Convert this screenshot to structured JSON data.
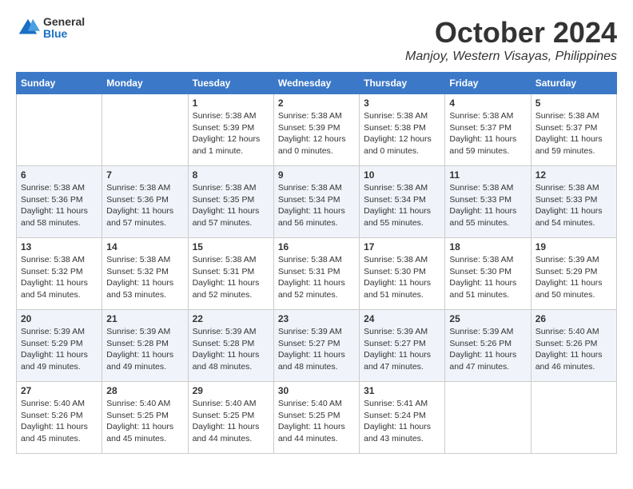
{
  "header": {
    "logo": {
      "general": "General",
      "blue": "Blue"
    },
    "title": "October 2024",
    "location": "Manjoy, Western Visayas, Philippines"
  },
  "weekdays": [
    "Sunday",
    "Monday",
    "Tuesday",
    "Wednesday",
    "Thursday",
    "Friday",
    "Saturday"
  ],
  "weeks": [
    [
      {
        "day": "",
        "sunrise": "",
        "sunset": "",
        "daylight": ""
      },
      {
        "day": "",
        "sunrise": "",
        "sunset": "",
        "daylight": ""
      },
      {
        "day": "1",
        "sunrise": "Sunrise: 5:38 AM",
        "sunset": "Sunset: 5:39 PM",
        "daylight": "Daylight: 12 hours and 1 minute."
      },
      {
        "day": "2",
        "sunrise": "Sunrise: 5:38 AM",
        "sunset": "Sunset: 5:39 PM",
        "daylight": "Daylight: 12 hours and 0 minutes."
      },
      {
        "day": "3",
        "sunrise": "Sunrise: 5:38 AM",
        "sunset": "Sunset: 5:38 PM",
        "daylight": "Daylight: 12 hours and 0 minutes."
      },
      {
        "day": "4",
        "sunrise": "Sunrise: 5:38 AM",
        "sunset": "Sunset: 5:37 PM",
        "daylight": "Daylight: 11 hours and 59 minutes."
      },
      {
        "day": "5",
        "sunrise": "Sunrise: 5:38 AM",
        "sunset": "Sunset: 5:37 PM",
        "daylight": "Daylight: 11 hours and 59 minutes."
      }
    ],
    [
      {
        "day": "6",
        "sunrise": "Sunrise: 5:38 AM",
        "sunset": "Sunset: 5:36 PM",
        "daylight": "Daylight: 11 hours and 58 minutes."
      },
      {
        "day": "7",
        "sunrise": "Sunrise: 5:38 AM",
        "sunset": "Sunset: 5:36 PM",
        "daylight": "Daylight: 11 hours and 57 minutes."
      },
      {
        "day": "8",
        "sunrise": "Sunrise: 5:38 AM",
        "sunset": "Sunset: 5:35 PM",
        "daylight": "Daylight: 11 hours and 57 minutes."
      },
      {
        "day": "9",
        "sunrise": "Sunrise: 5:38 AM",
        "sunset": "Sunset: 5:34 PM",
        "daylight": "Daylight: 11 hours and 56 minutes."
      },
      {
        "day": "10",
        "sunrise": "Sunrise: 5:38 AM",
        "sunset": "Sunset: 5:34 PM",
        "daylight": "Daylight: 11 hours and 55 minutes."
      },
      {
        "day": "11",
        "sunrise": "Sunrise: 5:38 AM",
        "sunset": "Sunset: 5:33 PM",
        "daylight": "Daylight: 11 hours and 55 minutes."
      },
      {
        "day": "12",
        "sunrise": "Sunrise: 5:38 AM",
        "sunset": "Sunset: 5:33 PM",
        "daylight": "Daylight: 11 hours and 54 minutes."
      }
    ],
    [
      {
        "day": "13",
        "sunrise": "Sunrise: 5:38 AM",
        "sunset": "Sunset: 5:32 PM",
        "daylight": "Daylight: 11 hours and 54 minutes."
      },
      {
        "day": "14",
        "sunrise": "Sunrise: 5:38 AM",
        "sunset": "Sunset: 5:32 PM",
        "daylight": "Daylight: 11 hours and 53 minutes."
      },
      {
        "day": "15",
        "sunrise": "Sunrise: 5:38 AM",
        "sunset": "Sunset: 5:31 PM",
        "daylight": "Daylight: 11 hours and 52 minutes."
      },
      {
        "day": "16",
        "sunrise": "Sunrise: 5:38 AM",
        "sunset": "Sunset: 5:31 PM",
        "daylight": "Daylight: 11 hours and 52 minutes."
      },
      {
        "day": "17",
        "sunrise": "Sunrise: 5:38 AM",
        "sunset": "Sunset: 5:30 PM",
        "daylight": "Daylight: 11 hours and 51 minutes."
      },
      {
        "day": "18",
        "sunrise": "Sunrise: 5:38 AM",
        "sunset": "Sunset: 5:30 PM",
        "daylight": "Daylight: 11 hours and 51 minutes."
      },
      {
        "day": "19",
        "sunrise": "Sunrise: 5:39 AM",
        "sunset": "Sunset: 5:29 PM",
        "daylight": "Daylight: 11 hours and 50 minutes."
      }
    ],
    [
      {
        "day": "20",
        "sunrise": "Sunrise: 5:39 AM",
        "sunset": "Sunset: 5:29 PM",
        "daylight": "Daylight: 11 hours and 49 minutes."
      },
      {
        "day": "21",
        "sunrise": "Sunrise: 5:39 AM",
        "sunset": "Sunset: 5:28 PM",
        "daylight": "Daylight: 11 hours and 49 minutes."
      },
      {
        "day": "22",
        "sunrise": "Sunrise: 5:39 AM",
        "sunset": "Sunset: 5:28 PM",
        "daylight": "Daylight: 11 hours and 48 minutes."
      },
      {
        "day": "23",
        "sunrise": "Sunrise: 5:39 AM",
        "sunset": "Sunset: 5:27 PM",
        "daylight": "Daylight: 11 hours and 48 minutes."
      },
      {
        "day": "24",
        "sunrise": "Sunrise: 5:39 AM",
        "sunset": "Sunset: 5:27 PM",
        "daylight": "Daylight: 11 hours and 47 minutes."
      },
      {
        "day": "25",
        "sunrise": "Sunrise: 5:39 AM",
        "sunset": "Sunset: 5:26 PM",
        "daylight": "Daylight: 11 hours and 47 minutes."
      },
      {
        "day": "26",
        "sunrise": "Sunrise: 5:40 AM",
        "sunset": "Sunset: 5:26 PM",
        "daylight": "Daylight: 11 hours and 46 minutes."
      }
    ],
    [
      {
        "day": "27",
        "sunrise": "Sunrise: 5:40 AM",
        "sunset": "Sunset: 5:26 PM",
        "daylight": "Daylight: 11 hours and 45 minutes."
      },
      {
        "day": "28",
        "sunrise": "Sunrise: 5:40 AM",
        "sunset": "Sunset: 5:25 PM",
        "daylight": "Daylight: 11 hours and 45 minutes."
      },
      {
        "day": "29",
        "sunrise": "Sunrise: 5:40 AM",
        "sunset": "Sunset: 5:25 PM",
        "daylight": "Daylight: 11 hours and 44 minutes."
      },
      {
        "day": "30",
        "sunrise": "Sunrise: 5:40 AM",
        "sunset": "Sunset: 5:25 PM",
        "daylight": "Daylight: 11 hours and 44 minutes."
      },
      {
        "day": "31",
        "sunrise": "Sunrise: 5:41 AM",
        "sunset": "Sunset: 5:24 PM",
        "daylight": "Daylight: 11 hours and 43 minutes."
      },
      {
        "day": "",
        "sunrise": "",
        "sunset": "",
        "daylight": ""
      },
      {
        "day": "",
        "sunrise": "",
        "sunset": "",
        "daylight": ""
      }
    ]
  ]
}
